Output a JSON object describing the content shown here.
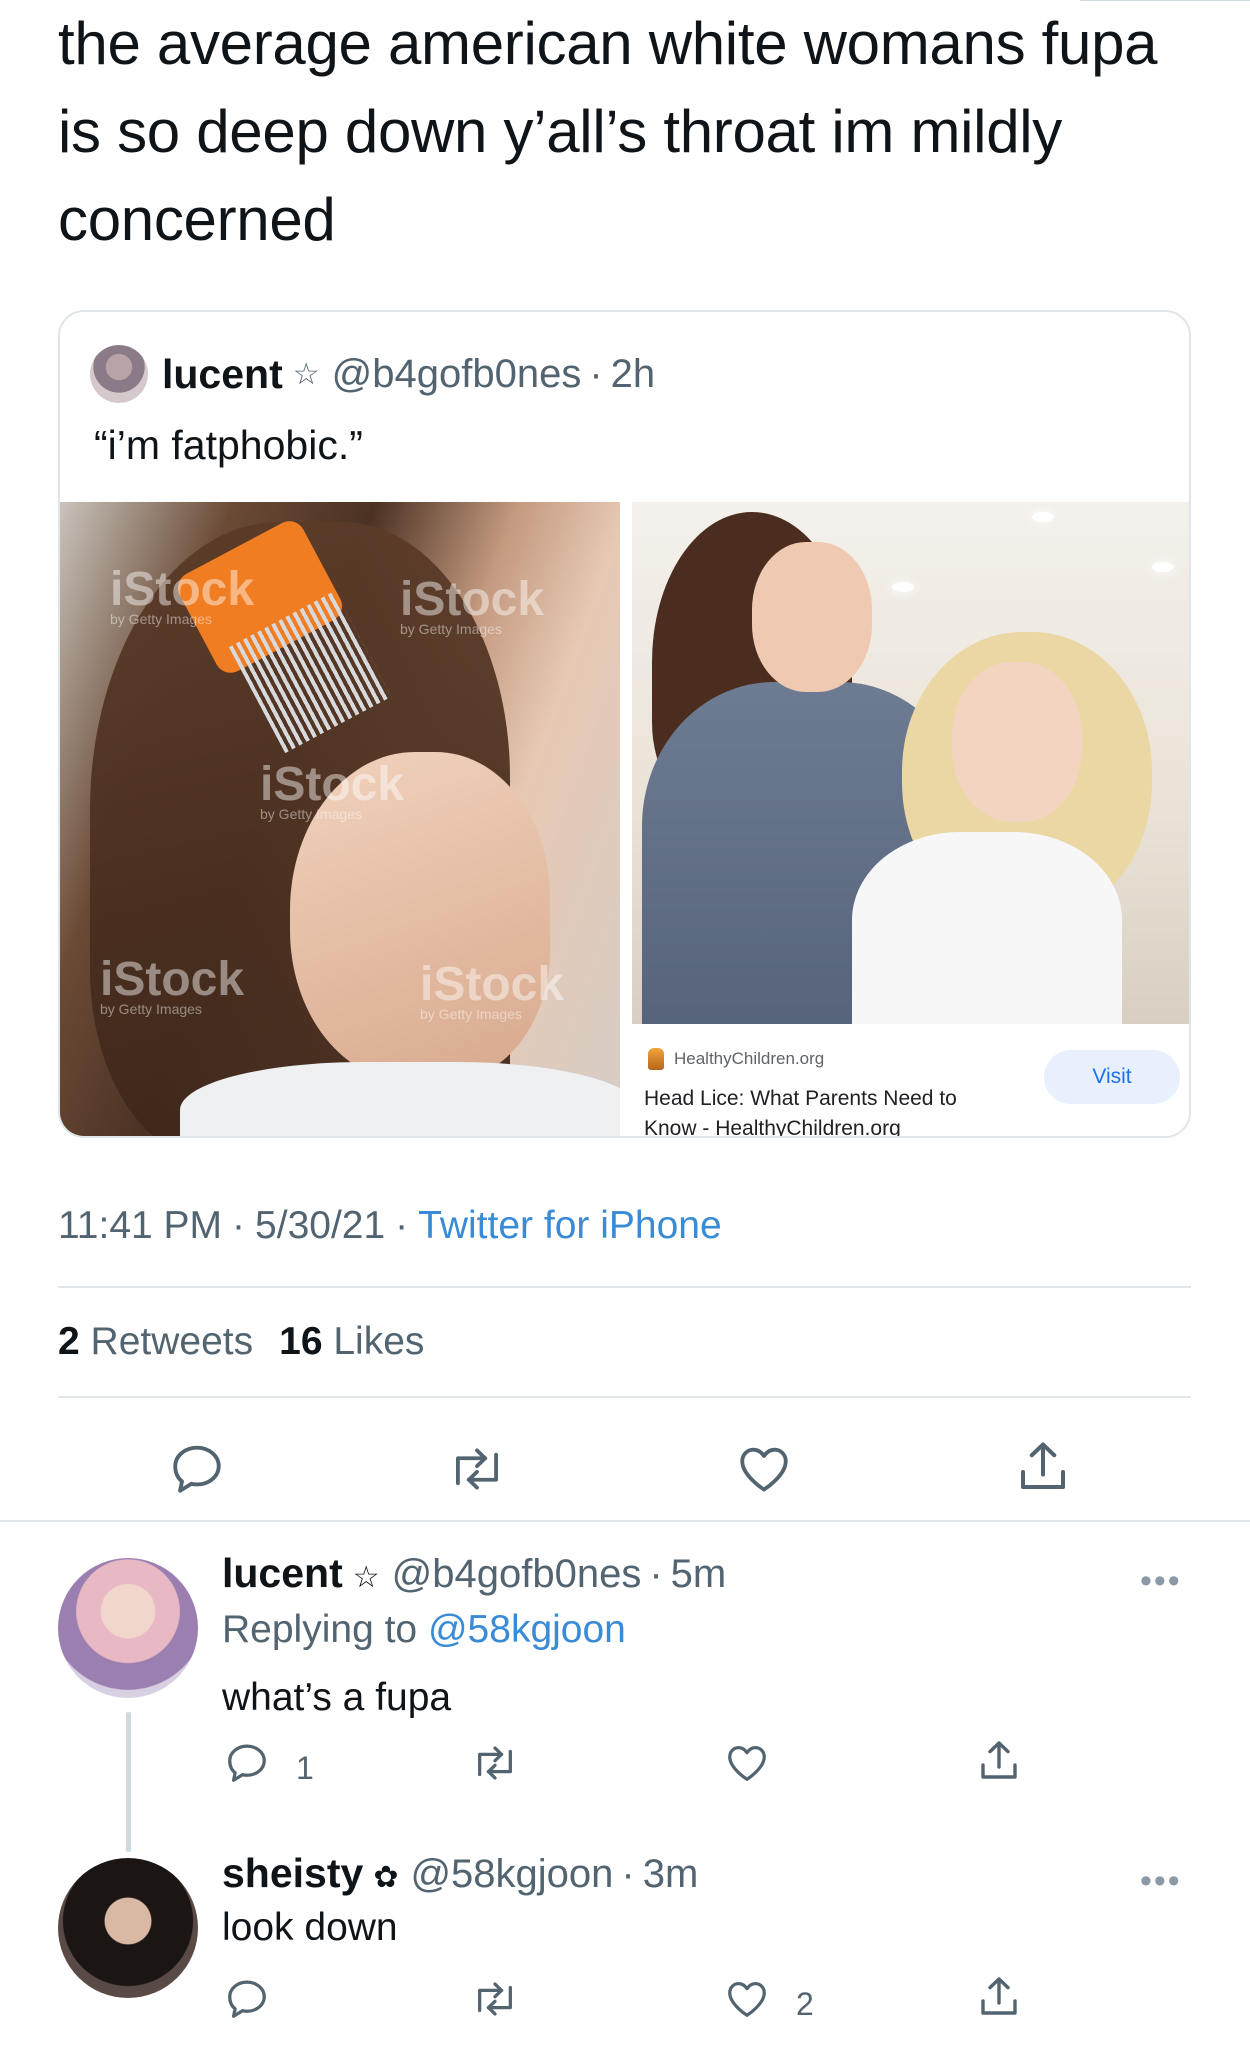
{
  "tweet": {
    "text": "the average american white womans fupa is so deep down y’all’s throat im mildly concerned",
    "time": "11:41 PM",
    "date": "5/30/21",
    "source": "Twitter for iPhone",
    "retweets_count": "2",
    "retweets_label": "Retweets",
    "likes_count": "16",
    "likes_label": "Likes"
  },
  "quote": {
    "name": "lucent",
    "badge": "☆",
    "handle": "@b4gofb0nes",
    "time": "2h",
    "text": "“i’m fatphobic.”",
    "watermark": "iStock",
    "watermark_sub": "by Getty Images",
    "link_card": {
      "site": "HealthyChildren.org",
      "title": "Head Lice: What Parents Need to Know - HealthyChildren.org",
      "button": "Visit"
    }
  },
  "replies": [
    {
      "name": "lucent",
      "badge": "☆",
      "handle": "@b4gofb0nes",
      "time": "5m",
      "replying_prefix": "Replying to",
      "replying_to": "@58kgjoon",
      "text": "what’s a fupa",
      "reply_count": "1",
      "like_count": ""
    },
    {
      "name": "sheisty",
      "badge": "✿",
      "handle": "@58kgjoon",
      "time": "3m",
      "text": "look down",
      "reply_count": "",
      "like_count": "2"
    }
  ],
  "icons": {
    "more": "•••",
    "dot": "·"
  },
  "colors": {
    "link": "#3a8bd6",
    "secondary": "#536471",
    "divider": "#e1e6ea"
  }
}
